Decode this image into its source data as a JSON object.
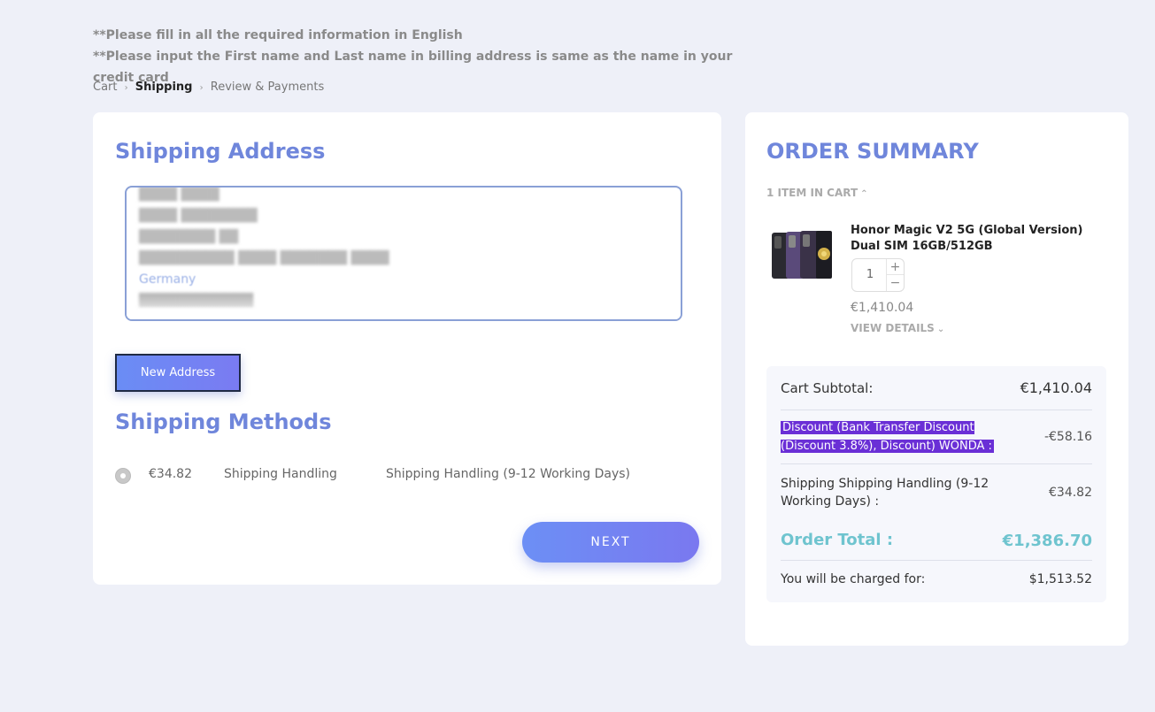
{
  "notes": [
    "**Please fill in all the required information in English",
    "**Please input the First name and Last name in billing address is same as the name in your credit card"
  ],
  "breadcrumb": {
    "cart": "Cart",
    "shipping": "Shipping",
    "review": "Review & Payments",
    "separator": "›"
  },
  "shipping_address": {
    "title": "Shipping Address",
    "address_lines": [
      "████ ████",
      "████ ████████",
      "████████ ██",
      "██████████ ████ ███████ ████",
      "Germany",
      "████████████"
    ],
    "new_address_label": "New Address"
  },
  "shipping_methods": {
    "title": "Shipping Methods",
    "price": "€34.82",
    "carrier": "Shipping Handling",
    "method": "Shipping Handling (9-12 Working Days)"
  },
  "next_label": "NEXT",
  "order_summary": {
    "title": "ORDER SUMMARY",
    "items_in_cart": "1 ITEM IN CART",
    "product": {
      "name": "Honor Magic V2 5G (Global Version) Dual SIM 16GB/512GB",
      "qty": "1",
      "price": "€1,410.04",
      "view_details": "VIEW DETAILS"
    },
    "rows": {
      "subtotal_label": "Cart Subtotal:",
      "subtotal_value": "€1,410.04",
      "discount_label": "Discount (Bank Transfer Discount (Discount 3.8%), Discount) WONDA :",
      "discount_value": "-€58.16",
      "shipping_label": "Shipping Shipping Handling (9-12 Working Days) :",
      "shipping_value": "€34.82",
      "total_label": "Order Total :",
      "total_value": "€1,386.70",
      "charged_label": "You will be charged for:",
      "charged_value": "$1,513.52"
    }
  },
  "colors": {
    "accent": "#6f86db",
    "total": "#6fc4cf",
    "highlight": "#6a2fd6"
  }
}
